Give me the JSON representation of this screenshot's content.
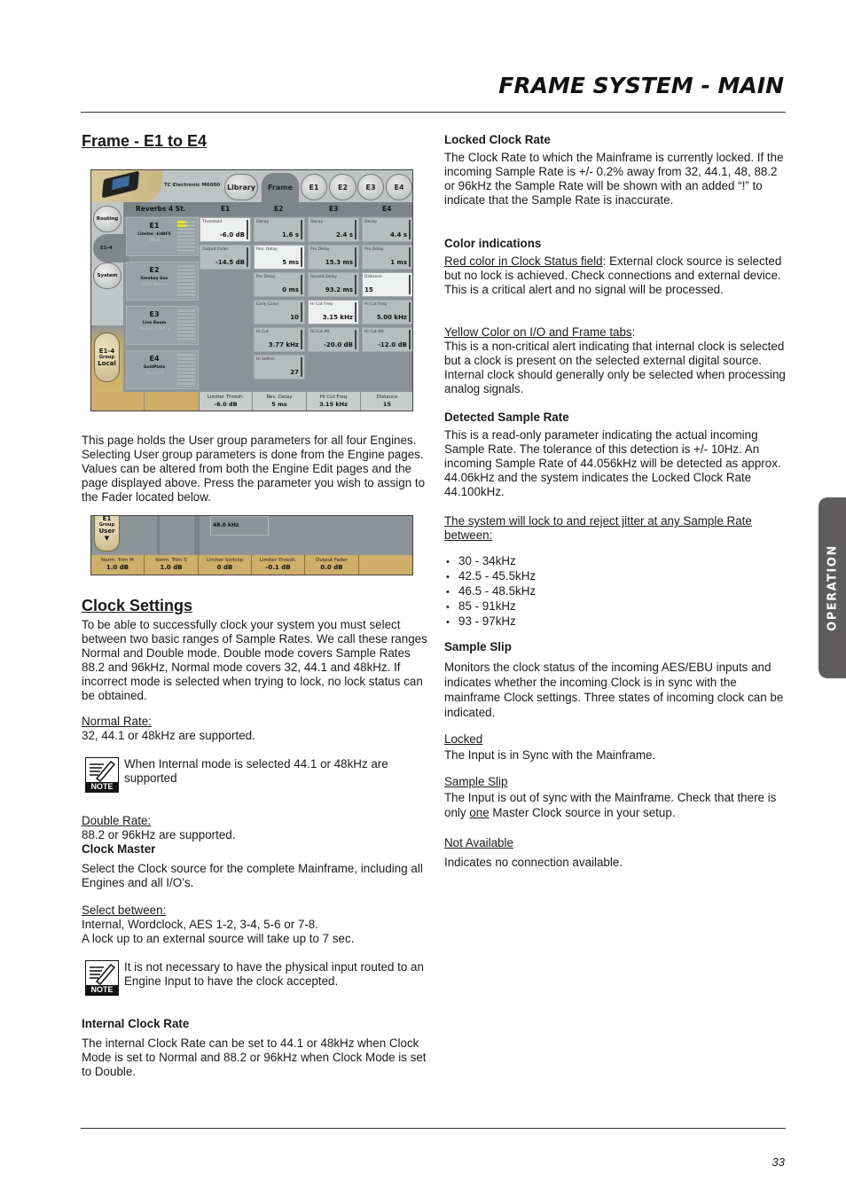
{
  "header": {
    "title": "FRAME SYSTEM - MAIN"
  },
  "side_tab": {
    "label": "OPERATION"
  },
  "footer": {
    "page_number": "33"
  },
  "left": {
    "frame_heading": "Frame - E1 to E4",
    "frame_body": "This page holds the User group parameters for all four Engines. Selecting User group parameters is done from the Engine pages. Values can be altered from both the Engine Edit pages and the page displayed above. Press the parameter you wish to assign to the Fader located below.",
    "clock_heading": "Clock Settings",
    "clock_body": "To be able to successfully clock your system you must select between two basic ranges of Sample Rates. We call these ranges Normal and Double mode. Double mode covers Sample Rates 88.2 and 96kHz, Normal mode covers 32, 44.1 and 48kHz. If incorrect mode is selected when trying to lock, no lock status can be obtained.",
    "normal_rate_label": "Normal Rate: ",
    "normal_rate_text": "32, 44.1 or 48kHz are supported.",
    "note1": "When Internal mode is selected 44.1 or 48kHz are supported",
    "note_label": "NOTE",
    "double_rate_label": "Double Rate:",
    "double_rate_text": "88.2 or 96kHz are supported.",
    "clock_master_heading": "Clock Master",
    "clock_master_body": "Select the Clock source for the complete Mainframe, including all Engines and all I/O’s.",
    "select_between_label": "Select between: ",
    "select_between_line1": "Internal, Wordclock, AES 1-2, 3-4, 5-6 or 7-8.",
    "select_between_line2": "A lock up to an external source will take up to 7 sec.",
    "note2": " It is not necessary to have the physical input routed to an Engine Input to have the clock accepted.",
    "internal_heading": "Internal Clock Rate",
    "internal_body": "The internal Clock Rate can be set to 44.1 or 48kHz when Clock Mode is set to Normal and  88.2 or 96kHz when Clock Mode is set to Double."
  },
  "right": {
    "locked_heading": "Locked Clock Rate",
    "locked_body": "The Clock Rate to which the Mainframe is currently locked. If the incoming Sample Rate is +/- 0.2% away from 32, 44.1, 48, 88.2 or 96kHz the Sample Rate will be shown with an added “!” to indicate that the Sample Rate is inaccurate.",
    "color_heading": "Color indications",
    "red_label": "Red color in Clock Status field",
    "red_body": ": External clock source is selected but no lock is achieved. Check connections and external device. This is a critical alert and no signal will be processed.",
    "yellow_label": "Yellow Color on I/O and Frame tabs",
    "yellow_colon": ":",
    "yellow_body": "This is a non-critical alert indicating that internal clock is selected but a clock is present on the selected external digital source. Internal clock should generally only be selected when processing analog signals.",
    "detected_heading": "Detected Sample Rate",
    "detected_body": "This is a read-only parameter indicating the actual incoming Sample Rate. The tolerance of this detection is +/- 10Hz. An incoming Sample Rate of 44.056kHz will be detected as approx. 44.06kHz and the system indicates the Locked Clock Rate 44.100kHz.",
    "jitter_label": "The system will lock to and reject jitter at any Sample Rate between:",
    "rates": [
      "30 - 34kHz",
      "42.5 - 45.5kHz",
      "46.5 - 48.5kHz",
      "85 - 91kHz",
      "93 - 97kHz"
    ],
    "slip_heading": "Sample Slip",
    "slip_body": "Monitors the clock status of the incoming AES/EBU inputs and indicates whether the incoming Clock is in sync with the mainframe Clock settings. Three states of incoming clock can be indicated.",
    "locked_label": "Locked",
    "locked_text": "The Input is in Sync with the Mainframe.",
    "sampleslip_label": "Sample Slip",
    "sampleslip_text_a": "The Input is out of sync with the Mainframe. Check that there is only ",
    "sampleslip_text_one": "one",
    "sampleslip_text_b": " Master Clock source in your setup.",
    "na_label": "Not Available",
    "na_text": "Indicates no connection available."
  },
  "ui_frame": {
    "brand": "TC Electronic M6000",
    "tabs": [
      "Library",
      "Frame",
      "E1",
      "E2",
      "E3",
      "E4"
    ],
    "active_tab": "Frame",
    "column_headers": [
      "Reverbs 4 St.",
      "E1",
      "E2",
      "E3",
      "E4"
    ],
    "nav": {
      "routing": "Routing",
      "e14": "E1-4",
      "system": "System"
    },
    "group": {
      "line1": "E1-4",
      "line2": "Group",
      "line3": "Local"
    },
    "engines": [
      {
        "name": "E1",
        "preset": "Limiter -6dBFS",
        "algo": "MD 3"
      },
      {
        "name": "E2",
        "preset": "Smokey Sax",
        "algo": "VSS3 Reverb"
      },
      {
        "name": "E3",
        "preset": "Live Room",
        "algo": "Reverb CORE 3"
      },
      {
        "name": "E4",
        "preset": "GoldPlate",
        "algo": "Reverb 3"
      }
    ],
    "e1_params": [
      {
        "label": "Threshold",
        "value": "-6.0 dB",
        "highlighted": true
      },
      {
        "label": "Output Fader",
        "value": "-14.5 dB",
        "highlighted": false
      }
    ],
    "e2_params": [
      {
        "label": "Decay",
        "value": "1.6 s",
        "highlighted": false
      },
      {
        "label": "Rev. Delay",
        "value": "5 ms",
        "highlighted": true
      },
      {
        "label": "Pre Delay",
        "value": "0 ms",
        "highlighted": false
      },
      {
        "label": "Early Color",
        "value": "10",
        "highlighted": false
      },
      {
        "label": "Hi Cut",
        "value": "3.77 kHz",
        "highlighted": false
      },
      {
        "label": "Hi Soften",
        "value": "27",
        "highlighted": false
      }
    ],
    "e3_params": [
      {
        "label": "Decay",
        "value": "2.4 s",
        "highlighted": false
      },
      {
        "label": "Pre Delay",
        "value": "15.3 ms",
        "highlighted": false
      },
      {
        "label": "Reverb Delay",
        "value": "93.2 ms",
        "highlighted": false
      },
      {
        "label": "Hi Cut Freq",
        "value": "3.15 kHz",
        "highlighted": true
      },
      {
        "label": "Hi Cut Att",
        "value": "-20.0 dB",
        "highlighted": false
      }
    ],
    "e4_params": [
      {
        "label": "Decay",
        "value": "4.4 s",
        "highlighted": false
      },
      {
        "label": "Pre Delay",
        "value": "1 ms",
        "highlighted": false
      },
      {
        "label": "Distance",
        "value": "15",
        "highlighted": true
      },
      {
        "label": "Hi Cut Freq",
        "value": "5.00 kHz",
        "highlighted": false
      },
      {
        "label": "Hi Cut Att",
        "value": "-12.0 dB",
        "highlighted": false
      }
    ],
    "faders": [
      {
        "label": "Limiter Thresh.",
        "value": "-6.0 dB"
      },
      {
        "label": "Rev. Delay",
        "value": "5 ms"
      },
      {
        "label": "Hi Cut Freq",
        "value": "3.15 kHz"
      },
      {
        "label": "Distance",
        "value": "15"
      }
    ]
  },
  "ui_fader": {
    "group": {
      "line1": "E1",
      "line2": "Group",
      "line3": "User"
    },
    "rate_value": "48.0 kHz",
    "faders": [
      {
        "label": "Norm. Trim M",
        "value": "1.0 dB"
      },
      {
        "label": "Norm. Trim S",
        "value": "1.0 dB"
      },
      {
        "label": "Limiter Softclip",
        "value": "0 dB"
      },
      {
        "label": "Limiter Thresh.",
        "value": "-0.1 dB"
      },
      {
        "label": "Output Fader",
        "value": "0.0 dB"
      }
    ]
  }
}
